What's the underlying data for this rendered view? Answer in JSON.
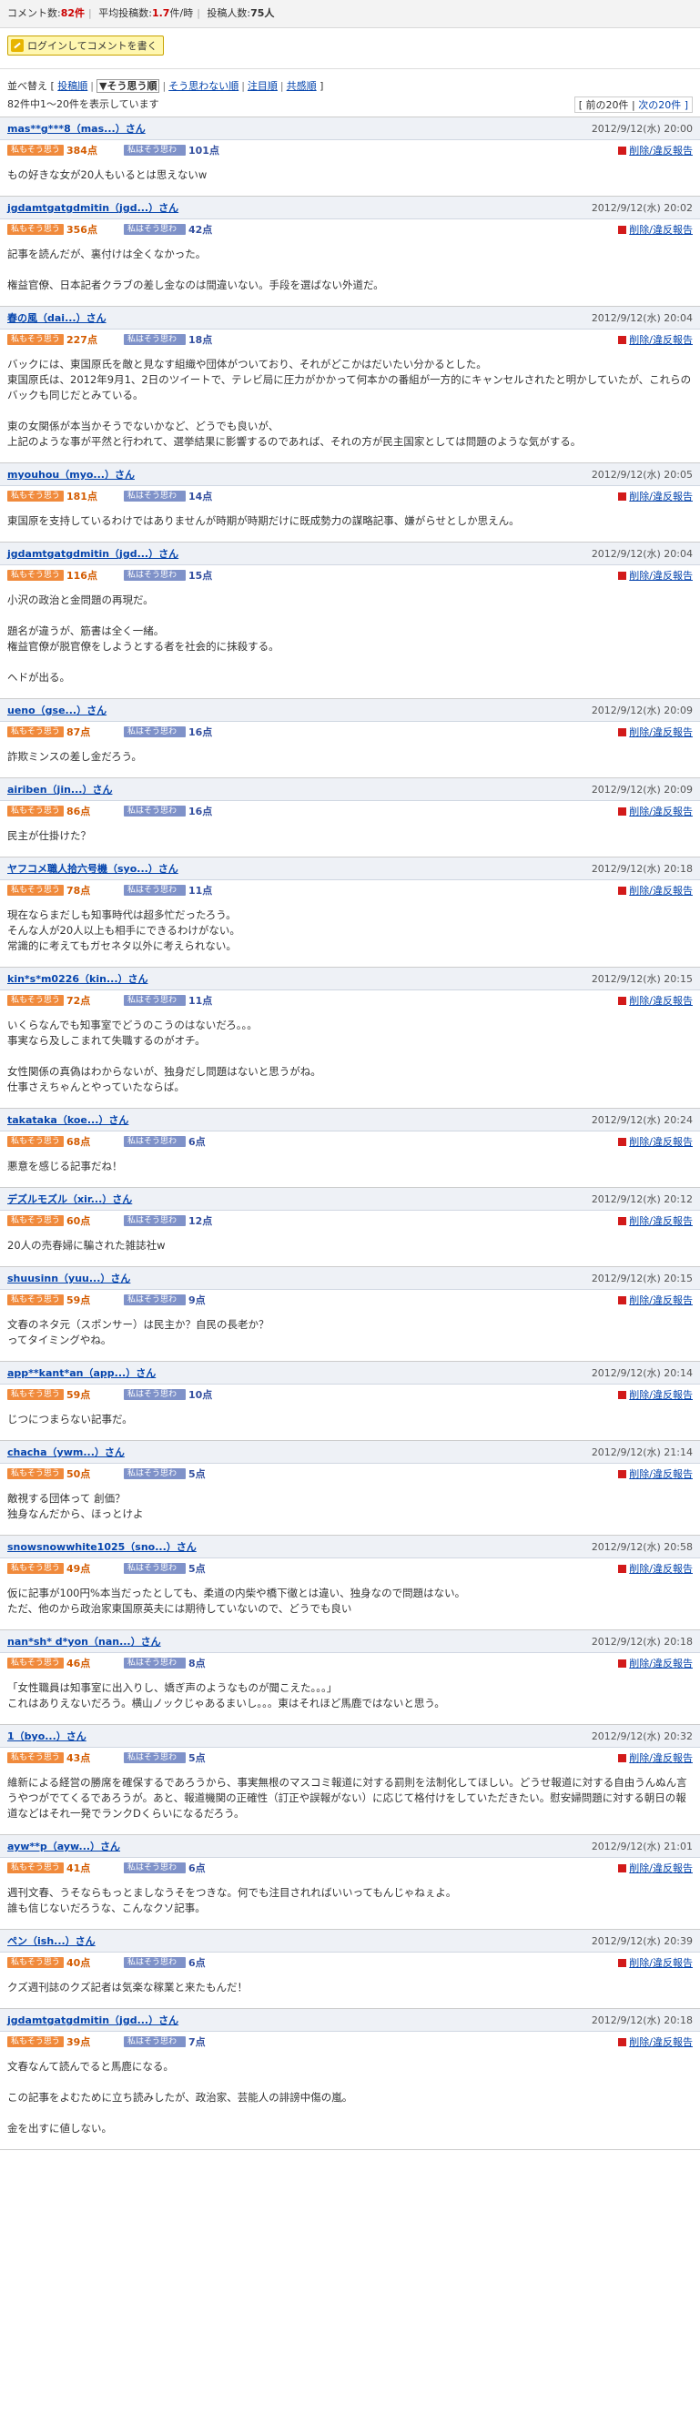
{
  "stats": {
    "comments_label": "コメント数:",
    "comments": "82件",
    "rate_label": "平均投稿数:",
    "rate": "1.7",
    "rate_unit": "件/時",
    "users_label": "投稿人数:",
    "users": "75人"
  },
  "login_label": "ログインしてコメントを書く",
  "sort": {
    "prefix": "並べ替え [",
    "items": [
      "投稿順",
      "そう思う順",
      "そう思わない順",
      "注目順",
      "共感順"
    ],
    "current": 1,
    "suffix": "]"
  },
  "count_text": "82件中1〜20件を表示しています",
  "pager": {
    "prev": "[ 前の20件",
    "next": "次の20件 ]"
  },
  "labels": {
    "agree": "私もそう思う",
    "disagree": "私はそう思わない",
    "points": "点",
    "report": "削除/違反報告"
  },
  "comments": [
    {
      "user": "mas**g***8（mas...）さん",
      "date": "2012/9/12(水) 20:00",
      "agree": "384",
      "disagree": "101",
      "body": "もの好きな女が20人もいるとは思えないw"
    },
    {
      "user": "jgdamtgatgdmitin（jgd...）さん",
      "date": "2012/9/12(水) 20:02",
      "agree": "356",
      "disagree": "42",
      "body": "記事を読んだが、裏付けは全くなかった。\n\n権益官僚、日本記者クラブの差し金なのは間違いない。手段を選ばない外道だ。"
    },
    {
      "user": "春の風（dai...）さん",
      "date": "2012/9/12(水) 20:04",
      "agree": "227",
      "disagree": "18",
      "body": "バックには、東国原氏を敵と見なす組織や団体がついており、それがどこかはだいたい分かるとした。\n東国原氏は、2012年9月1、2日のツイートで、テレビ局に圧力がかかって何本かの番組が一方的にキャンセルされたと明かしていたが、これらのバックも同じだとみている。\n\n東の女関係が本当かそうでないかなど、どうでも良いが、\n上記のような事が平然と行われて、選挙結果に影響するのであれば、それの方が民主国家としては問題のような気がする。"
    },
    {
      "user": "myouhou（myo...）さん",
      "date": "2012/9/12(水) 20:05",
      "agree": "181",
      "disagree": "14",
      "body": "東国原を支持しているわけではありませんが時期が時期だけに既成勢力の謀略記事、嫌がらせとしか思えん。"
    },
    {
      "user": "jgdamtgatgdmitin（jgd...）さん",
      "date": "2012/9/12(水) 20:04",
      "agree": "116",
      "disagree": "15",
      "body": "小沢の政治と金問題の再現だ。\n\n題名が違うが、筋書は全く一緒。\n権益官僚が脱官僚をしようとする者を社会的に抹殺する。\n\nヘドが出る。"
    },
    {
      "user": "ueno（gse...）さん",
      "date": "2012/9/12(水) 20:09",
      "agree": "87",
      "disagree": "16",
      "body": "詐欺ミンスの差し金だろう。"
    },
    {
      "user": "airiben（jin...）さん",
      "date": "2012/9/12(水) 20:09",
      "agree": "86",
      "disagree": "16",
      "body": "民主が仕掛けた？"
    },
    {
      "user": "ヤフコメ職人拾六号機（syo...）さん",
      "date": "2012/9/12(水) 20:18",
      "agree": "78",
      "disagree": "11",
      "body": "現在ならまだしも知事時代は超多忙だったろう。\nそんな人が20人以上も相手にできるわけがない。\n常識的に考えてもガセネタ以外に考えられない。"
    },
    {
      "user": "kin*s*m0226（kin...）さん",
      "date": "2012/9/12(水) 20:15",
      "agree": "72",
      "disagree": "11",
      "body": "いくらなんでも知事室でどうのこうのはないだろ。。。\n事実なら及しこまれて失職するのがオチ。\n\n女性関係の真偽はわからないが、独身だし問題はないと思うがね。\n仕事さえちゃんとやっていたならば。"
    },
    {
      "user": "takataka（koe...）さん",
      "date": "2012/9/12(水) 20:24",
      "agree": "68",
      "disagree": "6",
      "body": "悪意を感じる記事だね！"
    },
    {
      "user": "デズルモズル（xir...）さん",
      "date": "2012/9/12(水) 20:12",
      "agree": "60",
      "disagree": "12",
      "body": "20人の売春婦に騙された雑誌社w"
    },
    {
      "user": "shuusinn（yuu...）さん",
      "date": "2012/9/12(水) 20:15",
      "agree": "59",
      "disagree": "9",
      "body": "文春のネタ元（スポンサー）は民主か？自民の長老か？\nってタイミングやね。"
    },
    {
      "user": "app**kant*an（app...）さん",
      "date": "2012/9/12(水) 20:14",
      "agree": "59",
      "disagree": "10",
      "body": "じつにつまらない記事だ。"
    },
    {
      "user": "chacha（ywm...）さん",
      "date": "2012/9/12(水) 21:14",
      "agree": "50",
      "disagree": "5",
      "body": "敵視する団体って 創価？\n独身なんだから、ほっとけよ"
    },
    {
      "user": "snowsnowwhite1025（sno...）さん",
      "date": "2012/9/12(水) 20:58",
      "agree": "49",
      "disagree": "5",
      "body": "仮に記事が100円%本当だったとしても、柔道の内柴や橋下徹とは違い、独身なので問題はない。\nただ、他のから政治家東国原英夫には期待していないので、どうでも良い"
    },
    {
      "user": "nan*sh* d*yon（nan...）さん",
      "date": "2012/9/12(水) 20:18",
      "agree": "46",
      "disagree": "8",
      "body": "「女性職員は知事室に出入りし、嬌ぎ声のようなものが聞こえた。。。」\nこれはありえないだろう。横山ノックじゃあるまいし。。。東はそれほど馬鹿ではないと思う。"
    },
    {
      "user": "1（byo...）さん",
      "date": "2012/9/12(水) 20:32",
      "agree": "43",
      "disagree": "5",
      "body": "維新による経営の勝席を確保するであろうから、事実無根のマスコミ報道に対する罰則を法制化してほしい。どうせ報道に対する自由うんぬん言うやつがでてくるであろうが。あと、報道機関の正確性（訂正や誤報がない）に応じて格付けをしていただきたい。慰安婦問題に対する朝日の報道などはそれ一発でランクDくらいになるだろう。"
    },
    {
      "user": "ayw**p（ayw...）さん",
      "date": "2012/9/12(水) 21:01",
      "agree": "41",
      "disagree": "6",
      "body": "週刊文春、うそならもっとましなうそをつきな。何でも注目されればいいってもんじゃねぇよ。\n誰も信じないだろうな、こんなクソ記事。"
    },
    {
      "user": "ペン（ish...）さん",
      "date": "2012/9/12(水) 20:39",
      "agree": "40",
      "disagree": "6",
      "body": "クズ週刊誌のクズ記者は気楽な稼業と来たもんだ！"
    },
    {
      "user": "jgdamtgatgdmitin（jgd...）さん",
      "date": "2012/9/12(水) 20:18",
      "agree": "39",
      "disagree": "7",
      "body": "文春なんて読んでると馬鹿になる。\n\nこの記事をよむために立ち読みしたが、政治家、芸能人の誹謗中傷の嵐。\n\n金を出すに値しない。"
    }
  ]
}
